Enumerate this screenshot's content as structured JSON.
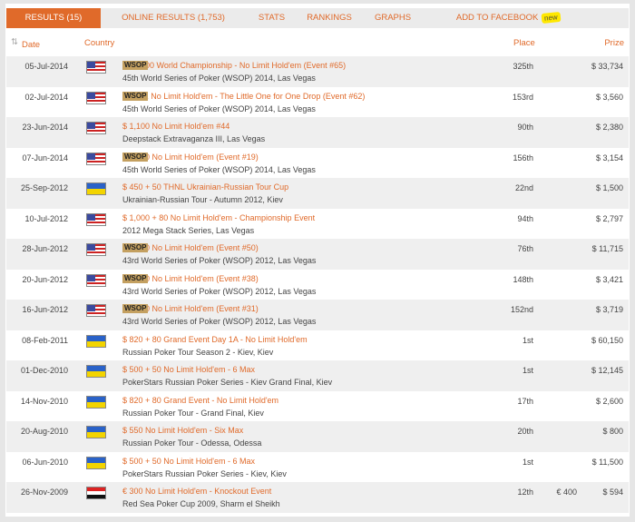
{
  "tabs": [
    {
      "label": "RESULTS (15)",
      "active": true
    },
    {
      "label": "ONLINE RESULTS (1,753)"
    },
    {
      "label": "STATS"
    },
    {
      "label": "RANKINGS"
    },
    {
      "label": "GRAPHS"
    },
    {
      "label": "ADD TO FACEBOOK",
      "badge": "new"
    }
  ],
  "columns": {
    "date": "Date",
    "country": "Country",
    "place": "Place",
    "prize": "Prize"
  },
  "colors": {
    "accent": "#e06a2a"
  },
  "rows": [
    {
      "date": "05-Jul-2014",
      "flag": "us",
      "wsop": "WSOP",
      "event": "$ 10,000 World Championship - No Limit Hold'em (Event #65)",
      "series": "45th World Series of Poker (WSOP) 2014, Las Vegas",
      "place": "325th",
      "prize": "$ 33,734"
    },
    {
      "date": "02-Jul-2014",
      "flag": "us",
      "wsop": "WSOP",
      "event": "$ 1,111 No Limit Hold'em - The Little One for One Drop (Event #62)",
      "series": "45th World Series of Poker (WSOP) 2014, Las Vegas",
      "place": "153rd",
      "prize": "$ 3,560"
    },
    {
      "date": "23-Jun-2014",
      "flag": "us",
      "event": "$ 1,100 No Limit Hold'em #44",
      "series": "Deepstack Extravaganza III, Las Vegas",
      "place": "90th",
      "prize": "$ 2,380"
    },
    {
      "date": "07-Jun-2014",
      "flag": "us",
      "wsop": "WSOP",
      "event": "$ 1,500 No Limit Hold'em (Event #19)",
      "series": "45th World Series of Poker (WSOP) 2014, Las Vegas",
      "place": "156th",
      "prize": "$ 3,154"
    },
    {
      "date": "25-Sep-2012",
      "flag": "ua",
      "event": "$ 450 + 50 THNL Ukrainian-Russian Tour Cup",
      "series": "Ukrainian-Russian Tour - Autumn 2012, Kiev",
      "place": "22nd",
      "prize": "$ 1,500"
    },
    {
      "date": "10-Jul-2012",
      "flag": "us",
      "event": "$ 1,000 + 80 No Limit Hold'em - Championship Event",
      "series": "2012 Mega Stack Series, Las Vegas",
      "place": "94th",
      "prize": "$ 2,797"
    },
    {
      "date": "28-Jun-2012",
      "flag": "us",
      "wsop": "WSOP",
      "event": "$ 5,000 No Limit Hold'em (Event #50)",
      "series": "43rd World Series of Poker (WSOP) 2012, Las Vegas",
      "place": "76th",
      "prize": "$ 11,715"
    },
    {
      "date": "20-Jun-2012",
      "flag": "us",
      "wsop": "WSOP",
      "event": "$ 1,500 No Limit Hold'em (Event #38)",
      "series": "43rd World Series of Poker (WSOP) 2012, Las Vegas",
      "place": "148th",
      "prize": "$ 3,421"
    },
    {
      "date": "16-Jun-2012",
      "flag": "us",
      "wsop": "WSOP",
      "event": "$ 1,500 No Limit Hold'em (Event #31)",
      "series": "43rd World Series of Poker (WSOP) 2012, Las Vegas",
      "place": "152nd",
      "prize": "$ 3,719"
    },
    {
      "date": "08-Feb-2011",
      "flag": "ua",
      "event": "$ 820 + 80 Grand Event Day 1A - No Limit Hold'em",
      "series": "Russian Poker Tour Season 2 - Kiev, Kiev",
      "place": "1st",
      "prize": "$ 60,150"
    },
    {
      "date": "01-Dec-2010",
      "flag": "ua",
      "event": "$ 500 + 50 No Limit Hold'em - 6 Max",
      "series": "PokerStars Russian Poker Series - Kiev Grand Final, Kiev",
      "place": "1st",
      "prize": "$ 12,145"
    },
    {
      "date": "14-Nov-2010",
      "flag": "ua",
      "event": "$ 820 + 80 Grand Event - No Limit Hold'em",
      "series": "Russian Poker Tour - Grand Final, Kiev",
      "place": "17th",
      "prize": "$ 2,600"
    },
    {
      "date": "20-Aug-2010",
      "flag": "ua",
      "event": "$ 550 No Limit Hold'em - Six Max",
      "series": "Russian Poker Tour - Odessa, Odessa",
      "place": "20th",
      "prize": "$ 800"
    },
    {
      "date": "06-Jun-2010",
      "flag": "ua",
      "event": "$ 500 + 50 No Limit Hold'em - 6 Max",
      "series": "PokerStars Russian Poker Series - Kiev, Kiev",
      "place": "1st",
      "prize": "$ 11,500"
    },
    {
      "date": "26-Nov-2009",
      "flag": "eg",
      "event": "€ 300 No Limit Hold'em - Knockout Event",
      "series": "Red Sea Poker Cup 2009, Sharm el Sheikh",
      "place": "12th",
      "local_prize": "€ 400",
      "prize": "$ 594"
    }
  ]
}
